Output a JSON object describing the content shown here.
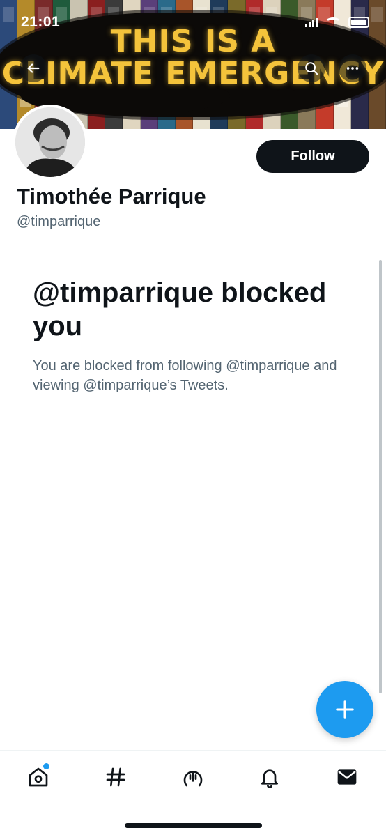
{
  "status_bar": {
    "time": "21:01"
  },
  "banner": {
    "line1": "THIS IS A",
    "line2": "CLIMATE EMERGENCY",
    "text_color": "#f4c33b",
    "book_colors": [
      "#2c4a7a",
      "#b48a2a",
      "#7a2a2a",
      "#1f5b3c",
      "#c9c3b0",
      "#8a1f1f",
      "#3b3b3b",
      "#e0d6c0",
      "#5a3f7a",
      "#2a6a8a",
      "#a8552a",
      "#e8e2d0",
      "#1f3b5a",
      "#7a6a2a",
      "#b02a2a",
      "#dcd2bc",
      "#3a5a2a",
      "#8a7a5a",
      "#c43b2a",
      "#f0e8d8",
      "#2a2a4a",
      "#6a4a2a"
    ]
  },
  "profile": {
    "display_name": "Timothée Parrique",
    "handle": "@timparrique",
    "follow_label": "Follow"
  },
  "blocked": {
    "title": "@timparrique blocked you",
    "body": "You are blocked from following @timparrique and viewing @timparrique’s Tweets."
  },
  "colors": {
    "accent": "#1d9bf0",
    "text": "#0f1419",
    "secondary": "#536471",
    "follow_bg": "#0f1419"
  },
  "icons": {
    "back": "back-arrow-icon",
    "search": "search-icon",
    "more": "more-icon",
    "compose": "plus-icon",
    "home": "home-icon",
    "explore": "hashtag-icon",
    "spaces": "spaces-icon",
    "notifications": "bell-icon",
    "messages": "mail-icon"
  }
}
